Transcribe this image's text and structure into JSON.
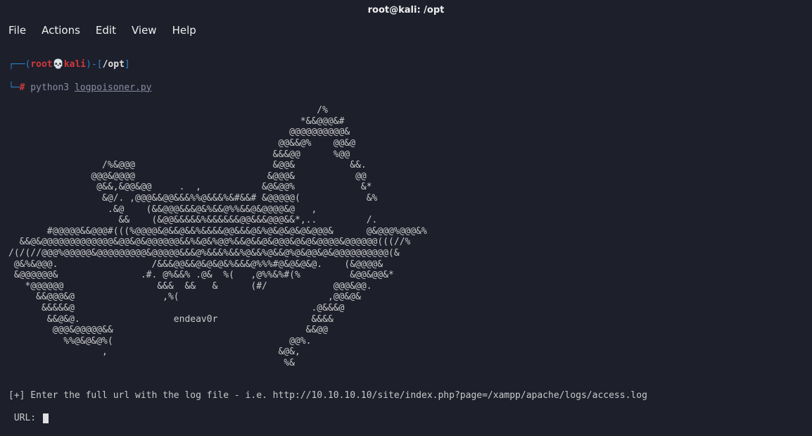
{
  "window": {
    "title": "root@kali: /opt"
  },
  "menu": {
    "file": "File",
    "actions": "Actions",
    "edit": "Edit",
    "view": "View",
    "help": "Help"
  },
  "prompt": {
    "corner1": "┌──",
    "paren_open": "(",
    "root": "root",
    "skull": "💀",
    "host": "kali",
    "paren_close": ")",
    "dash": "-",
    "bracket_open": "[",
    "path": "/opt",
    "bracket_close": "]",
    "corner2": "└─",
    "hash": "#",
    "cmd": " python3 ",
    "arg": "logpoisoner.py"
  },
  "ascii_art": "                                                        /%\n                                                     *&&@@@&#\n                                                   @@@@@@@@@@&\n                                                 @@&&@%    @@&@\n                                                &&&@@      %@@\n                 /%&@@@                         &@@&          &&.\n               @@@&@@@@                        &@@@&           @@\n                @&&,&@@&@@     .  ,           &@&@@%            &*\n                 &@/. ,@@@&&@@&&&%%@&&&%&#&&# &@@@@@(            &%\n                  .&@    (&&@@@&&&@&%&&@%%&&@&@@@@&@   ,\n                    &&    (&@@&&&&&%&&&&&&@@&&&@@@&&*,..         /.\n       #@@@@@&&@@@#(((%@@@@&@&&@&&%&&&&@@&&&@&%@&@&@&@&@@@&      @&@@@%@@@&%\n  &&@&@@@@@@@@@@@@@&@@&@&@@@@@@&&%&@&%@@%&&@&&@&@@@&@&@&@@@@&@@@@@@(((//%\n/(/(//@@@%@@@@@&@@@@@@@@@&@@@@@&&&@%&&&%&&%@&&%@&&@%@&@@&@&@@@@@@@@@@(&\n @&%&@@@.                 /&&&@@&&@&@&@&%&&&@%%%#@&@&@&@.    (&@@@@&\n &@@@@@@&               .#. @%&&% .@&  %(   ,@%%&%#(%         &@@&@@&*\n   *@@@@@@                 &&&  &&   &      (#/            @@@&@@.\n     &&@@@&@                ,%(                           ,@@&@&\n      &&&&&@                                           .@&&&@\n       &&@&@.                 endeav0r                 &&&&\n        @@@&@@@@@&&                                   &&@@\n          %%@&@&@%(                                @@%.\n                 ,                               &@&,\n                                                  %&",
  "info": {
    "prompt_text": "[+] Enter the full url with the log file - i.e. http://10.10.10.10/site/index.php?page=/xampp/apache/logs/access.log",
    "url_label": " URL: "
  }
}
